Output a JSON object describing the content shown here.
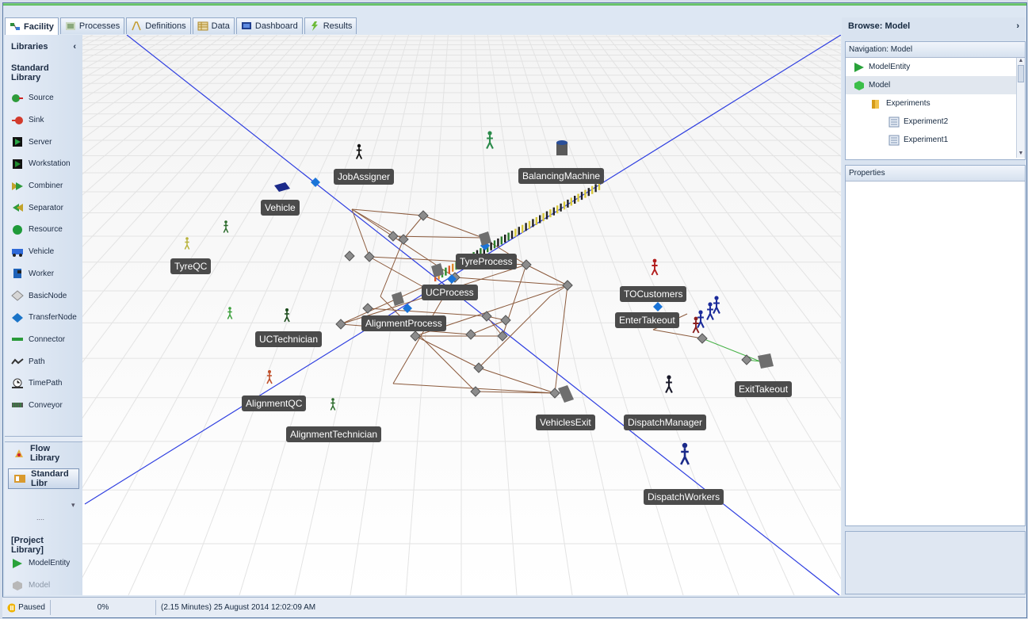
{
  "tabs": [
    {
      "label": "Facility",
      "icon": "facility-icon",
      "active": true
    },
    {
      "label": "Processes",
      "icon": "processes-icon"
    },
    {
      "label": "Definitions",
      "icon": "definitions-icon"
    },
    {
      "label": "Data",
      "icon": "data-icon"
    },
    {
      "label": "Dashboard",
      "icon": "dashboard-icon"
    },
    {
      "label": "Results",
      "icon": "results-icon"
    }
  ],
  "libraries": {
    "title": "Libraries",
    "section": "Standard Library",
    "items": [
      {
        "label": "Source",
        "icon": "source-icon",
        "color": "#2e9b3a"
      },
      {
        "label": "Sink",
        "icon": "sink-icon",
        "color": "#d23a2c"
      },
      {
        "label": "Server",
        "icon": "server-icon",
        "color": "#28a745"
      },
      {
        "label": "Workstation",
        "icon": "workstation-icon",
        "color": "#1e8c2e"
      },
      {
        "label": "Combiner",
        "icon": "combiner-icon",
        "color": "#2f9a3c"
      },
      {
        "label": "Separator",
        "icon": "separator-icon",
        "color": "#2f9a3c"
      },
      {
        "label": "Resource",
        "icon": "resource-icon",
        "color": "#1f9a3a"
      },
      {
        "label": "Vehicle",
        "icon": "vehicle-icon",
        "color": "#2f6ad8"
      },
      {
        "label": "Worker",
        "icon": "worker-icon",
        "color": "#1e62b8"
      },
      {
        "label": "BasicNode",
        "icon": "basic-node-icon",
        "color": "#9a9a9a"
      },
      {
        "label": "TransferNode",
        "icon": "transfer-node-icon",
        "color": "#1a74c8"
      },
      {
        "label": "Connector",
        "icon": "connector-icon",
        "color": "#2a9a3a"
      },
      {
        "label": "Path",
        "icon": "path-icon",
        "color": "#333333"
      },
      {
        "label": "TimePath",
        "icon": "timepath-icon",
        "color": "#333333"
      },
      {
        "label": "Conveyor",
        "icon": "conveyor-icon",
        "color": "#333333"
      }
    ],
    "flow_library": "Flow Library",
    "standard_library": "Standard Libr",
    "dots": "....",
    "project_library": "[Project Library]",
    "project_items": [
      {
        "label": "ModelEntity",
        "icon": "model-entity-icon"
      },
      {
        "label": "Model",
        "icon": "model-icon"
      }
    ]
  },
  "facility_labels": {
    "job_assigner": "JobAssigner",
    "balancing_machine": "BalancingMachine",
    "vehicle": "Vehicle",
    "tyre_process": "TyreProcess",
    "tyre_qc": "TyreQC",
    "uc_process": "UCProcess",
    "alignment_process": "AlignmentProcess",
    "to_customers": "TOCustomers",
    "enter_takeout": "EnterTakeout",
    "uc_technician": "UCTechnician",
    "exit_takeout": "ExitTakeout",
    "alignment_qc": "AlignmentQC",
    "vehicles_exit": "VehiclesExit",
    "dispatch_manager": "DispatchManager",
    "alignment_technician": "AlignmentTechnician",
    "dispatch_workers": "DispatchWorkers"
  },
  "browse": {
    "title": "Browse: Model",
    "navigation_title": "Navigation: Model",
    "tree": [
      {
        "label": "ModelEntity",
        "icon": "model-entity-icon",
        "indent": 0
      },
      {
        "label": "Model",
        "icon": "model-icon",
        "indent": 0,
        "selected": true
      },
      {
        "label": "Experiments",
        "icon": "folder-icon",
        "indent": 1
      },
      {
        "label": "Experiment2",
        "icon": "experiment-icon",
        "indent": 2
      },
      {
        "label": "Experiment1",
        "icon": "experiment-icon",
        "indent": 2
      }
    ],
    "properties_title": "Properties"
  },
  "status": {
    "state": "Paused",
    "progress": "0%",
    "progress_value": 0,
    "time": "(2.15 Minutes) 25 August 2014 12:02:09 AM"
  }
}
